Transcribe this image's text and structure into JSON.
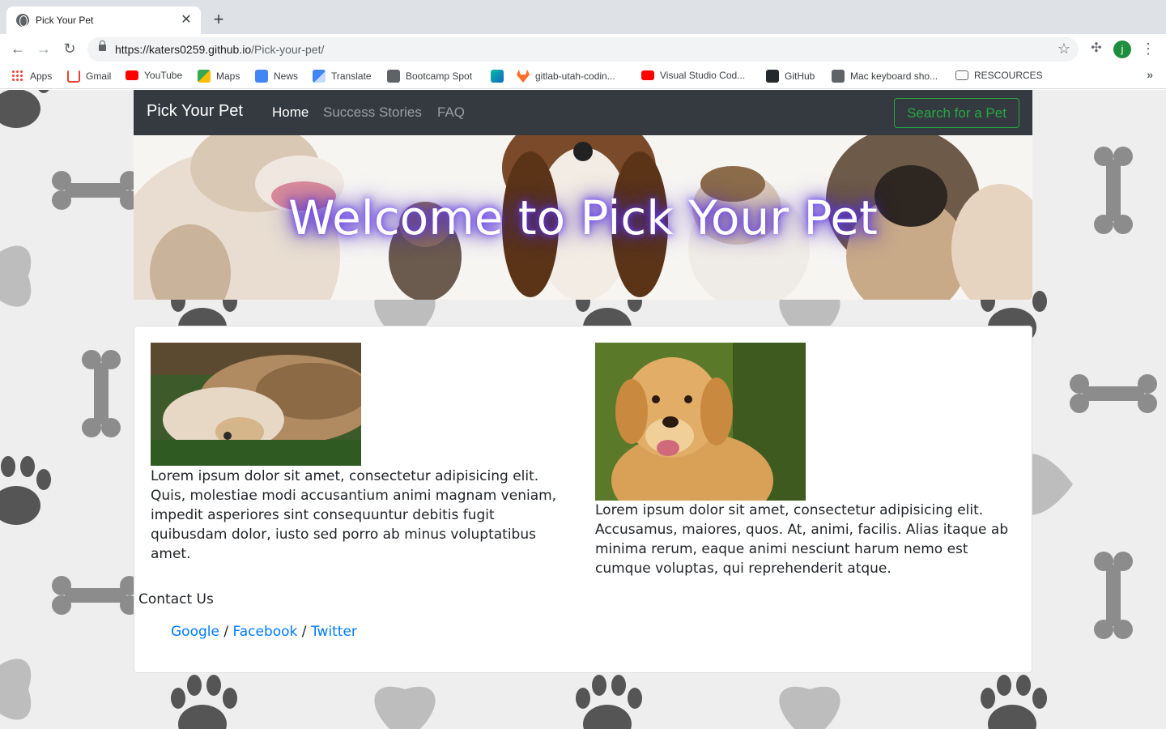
{
  "browser": {
    "tab_title": "Pick Your Pet",
    "url_host": "https://katers0259.github.io",
    "url_path": "/Pick-your-pet/",
    "profile_initial": "j",
    "bookmarks": [
      "Apps",
      "Gmail",
      "YouTube",
      "Maps",
      "News",
      "Translate",
      "Bootcamp Spot",
      "gitlab-utah-codin...",
      "Visual Studio Cod...",
      "GitHub",
      "Mac keyboard sho...",
      "RESCOURCES"
    ]
  },
  "site": {
    "brand": "Pick Your Pet",
    "nav": [
      "Home",
      "Success Stories",
      "FAQ"
    ],
    "search_button": "Search for a Pet",
    "hero_title": "Welcome to Pick Your Pet",
    "left_text": "Lorem ipsum dolor sit amet, consectetur adipisicing elit. Quis, molestiae modi accusantium animi magnam veniam, impedit asperiores sint consequuntur debitis fugit quibusdam dolor, iusto sed porro ab minus voluptatibus amet.",
    "right_text": "Lorem ipsum dolor sit amet, consectetur adipisicing elit. Accusamus, maiores, quos. At, animi, facilis. Alias itaque ab minima rerum, eaque animi nesciunt harum nemo est cumque voluptas, qui reprehenderit atque.",
    "contact_title": "Contact Us",
    "contact_links": [
      "Google",
      "Facebook",
      "Twitter"
    ],
    "separator": "/"
  },
  "colors": {
    "navbar_bg": "#343a40",
    "success_green": "#28a745",
    "link_blue": "#007bff",
    "page_bg": "#eeeeee"
  }
}
